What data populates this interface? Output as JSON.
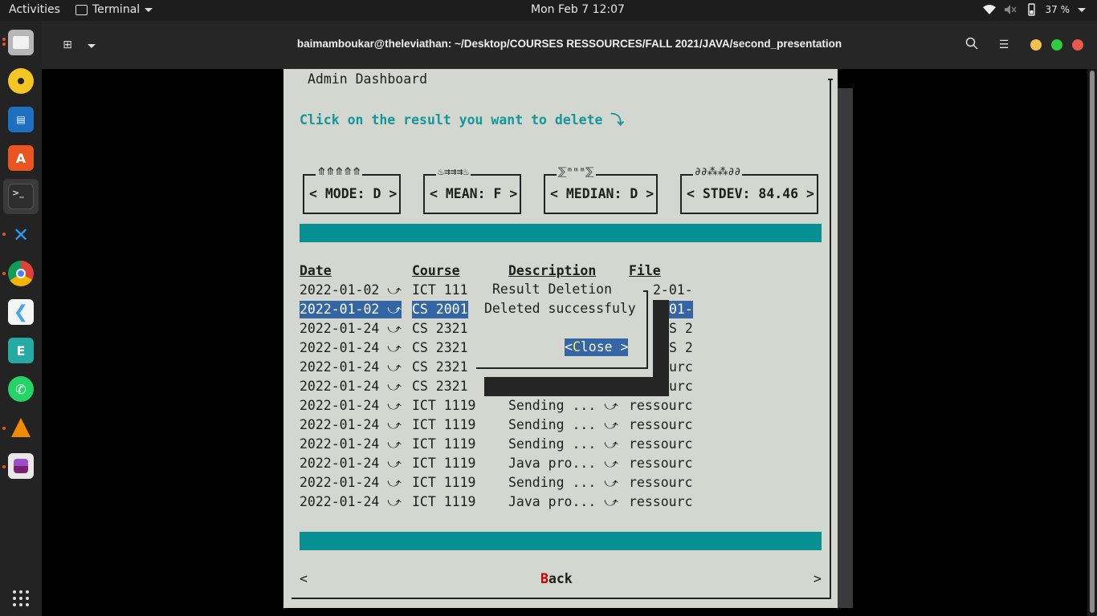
{
  "topbar": {
    "activities": "Activities",
    "app_name": "Terminal",
    "clock": "Mon Feb 7  12:07",
    "battery": "37 %"
  },
  "dock": {
    "icons": [
      "files-icon",
      "rhythmbox-icon",
      "writer-icon",
      "software-icon",
      "terminal-icon",
      "vscode-icon",
      "chrome-icon",
      "flutter-icon",
      "eclipse-icon",
      "whatsapp-icon",
      "vlc-icon",
      "tweaks-icon",
      "show-apps-icon"
    ]
  },
  "terminal": {
    "title": "baimamboukar@theleviathan: ~/Desktop/COURSES RESSOURCES/FALL 2021/JAVA/second_presentation"
  },
  "dialog": {
    "title": "Admin Dashboard",
    "instruction": "Click on the result you want to delete ⤵",
    "stats": [
      {
        "deco": "⤊⤊⤊⤊⤊",
        "label": "< MODE: D >"
      },
      {
        "deco": "♨⇉⇉⇉♨",
        "label": "< MEAN: F >"
      },
      {
        "deco": "⅀ᵐᵐᵐ⅀",
        "label": "< MEDIAN: D >"
      },
      {
        "deco": "∂∂⁂⁂∂∂",
        "label": "< STDEV: 84.46 >"
      }
    ],
    "headers": {
      "date": "Date",
      "course": "Course",
      "description": "Description",
      "file": "File"
    },
    "rows": [
      {
        "date": "2022-01-02 ⤻",
        "course": "ICT 111",
        "desc": "",
        "file": "2-01-"
      },
      {
        "date": "2022-01-02 ⤻",
        "course": "CS 2001",
        "desc": "",
        "file": "01-"
      },
      {
        "date": "2022-01-24 ⤻",
        "course": "CS 2321",
        "desc": "",
        "file": "S 2"
      },
      {
        "date": "2022-01-24 ⤻",
        "course": "CS 2321",
        "desc": "",
        "file": "S 2"
      },
      {
        "date": "2022-01-24 ⤻",
        "course": "CS 2321",
        "desc": "",
        "file": "urc"
      },
      {
        "date": "2022-01-24 ⤻",
        "course": "CS 2321",
        "desc": "",
        "file": "urc"
      },
      {
        "date": "2022-01-24 ⤻",
        "course": "ICT 1119",
        "desc": "Sending ... ⤻",
        "file": "ressourc"
      },
      {
        "date": "2022-01-24 ⤻",
        "course": "ICT 1119",
        "desc": "Sending ... ⤻",
        "file": "ressourc"
      },
      {
        "date": "2022-01-24 ⤻",
        "course": "ICT 1119",
        "desc": "Sending ... ⤻",
        "file": "ressourc"
      },
      {
        "date": "2022-01-24 ⤻",
        "course": "ICT 1119",
        "desc": "Java pro... ⤻",
        "file": "ressourc"
      },
      {
        "date": "2022-01-24 ⤻",
        "course": "ICT 1119",
        "desc": "Sending ... ⤻",
        "file": "ressourc"
      },
      {
        "date": "2022-01-24 ⤻",
        "course": "ICT 1119",
        "desc": "Java pro... ⤻",
        "file": "ressourc"
      }
    ],
    "nav_prev": "<",
    "back_hot": "B",
    "back_rest": "ack",
    "nav_next": ">"
  },
  "popup": {
    "title": "Result Deletion",
    "message": "Deleted successfuly",
    "close_open": "<",
    "close_hot": "C",
    "close_rest": "lose >"
  }
}
